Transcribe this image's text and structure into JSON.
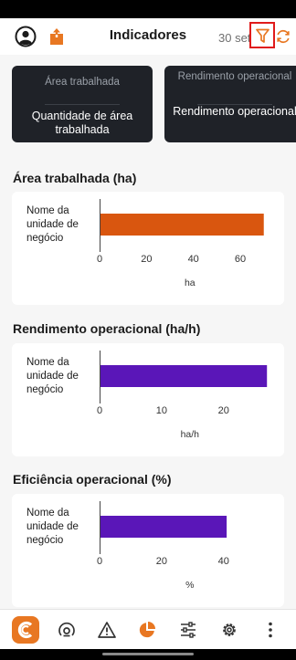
{
  "appbar": {
    "title": "Indicadores",
    "date": "30 set",
    "accent": "#e87722"
  },
  "top_cards": [
    {
      "title": "Área trabalhada",
      "value": "Quantidade de área trabalhada"
    },
    {
      "title": "Rendimento operacional",
      "value": "Rendimento operacional"
    }
  ],
  "charts_section": [
    {
      "title": "Área trabalhada (ha)"
    },
    {
      "title": "Rendimento operacional (ha/h)"
    },
    {
      "title": "Eficiência operacional (%)"
    }
  ],
  "chart_data": [
    {
      "type": "bar",
      "orientation": "horizontal",
      "title": "Área trabalhada (ha)",
      "categories": [
        "Nome da unidade de negócio"
      ],
      "values": [
        70
      ],
      "xlabel": "ha",
      "xlim": [
        0,
        74
      ],
      "xticks": [
        "0",
        "20",
        "40",
        "60"
      ],
      "color": "#d9560f"
    },
    {
      "type": "bar",
      "orientation": "horizontal",
      "title": "Rendimento operacional (ha/h)",
      "categories": [
        "Nome da unidade de negócio"
      ],
      "values": [
        27
      ],
      "xlabel": "ha/h",
      "xlim": [
        0,
        28
      ],
      "xticks": [
        "0",
        "10",
        "20"
      ],
      "color": "#5a16b8"
    },
    {
      "type": "bar",
      "orientation": "horizontal",
      "title": "Eficiência operacional (%)",
      "categories": [
        "Nome da unidade de negócio"
      ],
      "values": [
        41
      ],
      "xlabel": "%",
      "xlim": [
        0,
        56
      ],
      "xticks": [
        "0",
        "20",
        "40"
      ],
      "color": "#5a16b8"
    }
  ],
  "icons": {
    "avatar": "user-circle-icon",
    "share": "share-icon",
    "filter": "filter-icon",
    "refresh": "refresh-icon",
    "nav": [
      "app-logo-icon",
      "gauge-icon",
      "warning-icon",
      "pie-chart-icon",
      "sliders-icon",
      "gear-icon",
      "more-vertical-icon"
    ]
  }
}
